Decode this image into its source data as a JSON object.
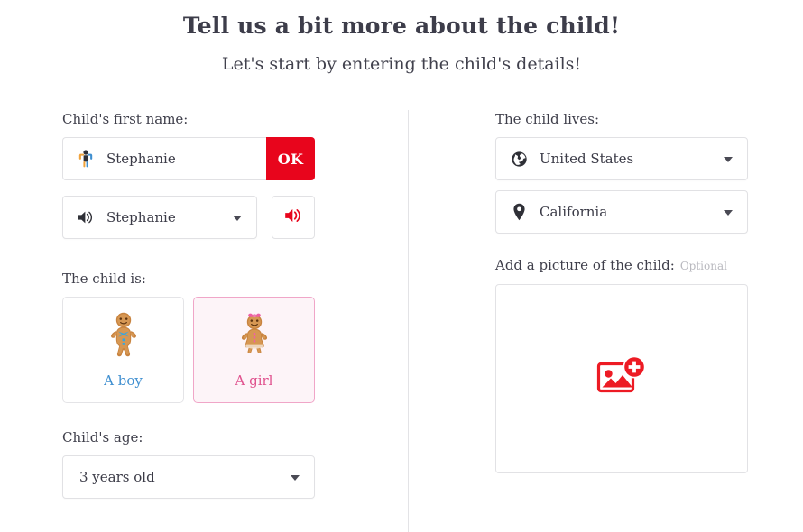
{
  "header": {
    "title": "Tell us a bit more about the child!",
    "subtitle": "Let's start by entering the child's details!"
  },
  "left": {
    "first_name": {
      "label": "Child's first name:",
      "icon": "child-person-icon",
      "value": "Stephanie",
      "placeholder": "Child's first name",
      "ok_label": "OK"
    },
    "pronunciation": {
      "icon": "speaker-icon",
      "value": "Stephanie",
      "play_icon": "speaker-play-icon"
    },
    "gender": {
      "label": "The child is:",
      "options": [
        {
          "label": "A boy",
          "icon": "gingerbread-boy-icon",
          "selected": false
        },
        {
          "label": "A girl",
          "icon": "gingerbread-girl-icon",
          "selected": true
        }
      ]
    },
    "age": {
      "label": "Child's age:",
      "value": "3 years old"
    }
  },
  "right": {
    "location": {
      "label": "The child lives:",
      "country": {
        "icon": "globe-icon",
        "value": "United States"
      },
      "state": {
        "icon": "map-pin-icon",
        "value": "California"
      }
    },
    "picture": {
      "label": "Add a picture of the child:",
      "optional_tag": "Optional",
      "icon": "add-image-icon"
    }
  },
  "colors": {
    "accent_red": "#e8051c",
    "boy_blue": "#3f8fd0",
    "girl_pink": "#e0538f",
    "girl_card_bg": "#fdf4f8",
    "girl_card_border": "#f0a6c8",
    "border_grey": "#e1e1e4",
    "text_dark": "#3b3b47",
    "optional_grey": "#b9b9bf"
  }
}
